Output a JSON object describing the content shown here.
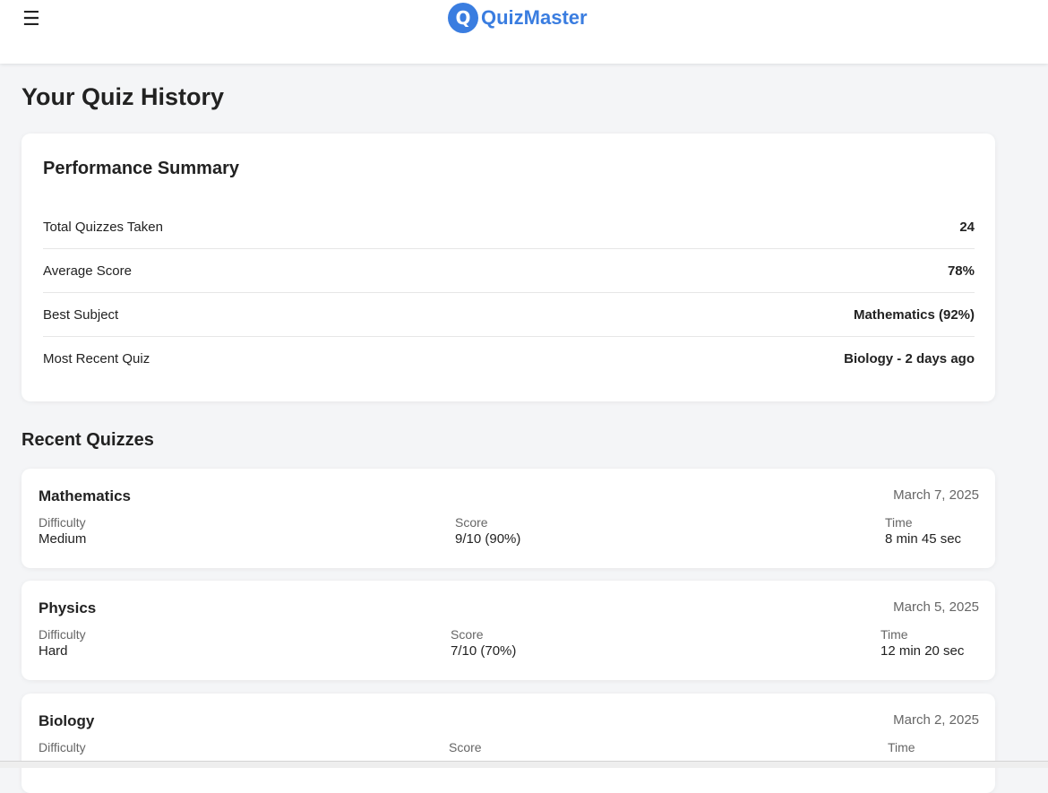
{
  "header": {
    "menu_icon": "hamburger-icon",
    "logo_letter": "Q",
    "brand_name": "QuizMaster",
    "accent_color": "#3a7de0"
  },
  "page": {
    "title": "Your Quiz History"
  },
  "summary": {
    "title": "Performance Summary",
    "rows": [
      {
        "label": "Total Quizzes Taken",
        "value": "24"
      },
      {
        "label": "Average Score",
        "value": "78%"
      },
      {
        "label": "Best Subject",
        "value": "Mathematics (92%)"
      },
      {
        "label": "Most Recent Quiz",
        "value": "Biology - 2 days ago"
      }
    ]
  },
  "recent": {
    "title": "Recent Quizzes",
    "quizzes": [
      {
        "subject": "Mathematics",
        "date": "March 7, 2025",
        "difficulty_label": "Difficulty",
        "difficulty": "Medium",
        "score_label": "Score",
        "score": "9/10 (90%)",
        "time_label": "Time",
        "time": "8 min 45 sec"
      },
      {
        "subject": "Physics",
        "date": "March 5, 2025",
        "difficulty_label": "Difficulty",
        "difficulty": "Hard",
        "score_label": "Score",
        "score": "7/10 (70%)",
        "time_label": "Time",
        "time": "12 min 20 sec"
      },
      {
        "subject": "Biology",
        "date": "March 2, 2025",
        "difficulty_label": "Difficulty",
        "difficulty": "",
        "score_label": "Score",
        "score": "",
        "time_label": "Time",
        "time": ""
      }
    ]
  }
}
